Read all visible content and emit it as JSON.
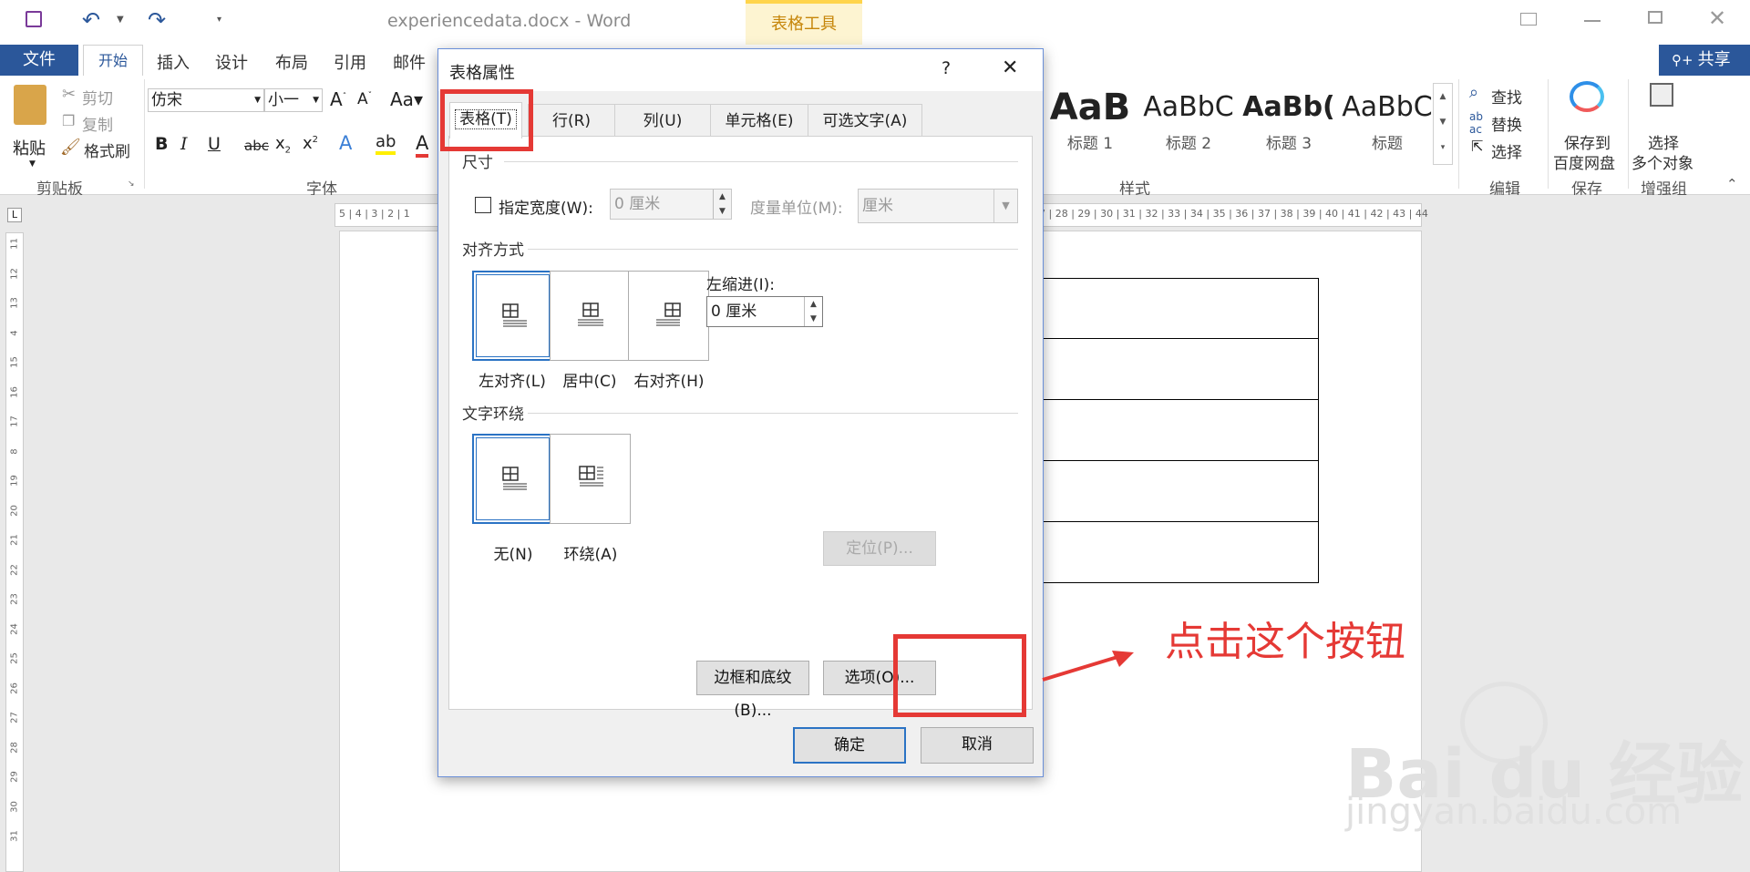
{
  "titlebar": {
    "doc_title": "experiencedata.docx - Word",
    "context_tab": "表格工具"
  },
  "tabs": {
    "file": "文件",
    "home": "开始",
    "insert": "插入",
    "design": "设计",
    "layout": "布局",
    "references": "引用",
    "mailings": "邮件",
    "share": "共享"
  },
  "ribbon": {
    "clipboard": {
      "paste": "粘贴",
      "cut": "剪切",
      "copy": "复制",
      "format_painter": "格式刷",
      "label": "剪贴板"
    },
    "font": {
      "name": "仿宋",
      "size": "小一",
      "label": "字体"
    },
    "styles": {
      "items": [
        {
          "preview": "AaB",
          "name": "标题 1"
        },
        {
          "preview": "AaBbC",
          "name": "标题 2"
        },
        {
          "preview": "AaBb(",
          "name": "标题 3"
        },
        {
          "preview": "AaBbC",
          "name": "标题"
        }
      ],
      "label": "样式"
    },
    "editing": {
      "find": "查找",
      "replace": "替换",
      "select": "选择",
      "label": "编辑"
    },
    "save": {
      "line1": "保存到",
      "line2": "百度网盘",
      "label": "保存"
    },
    "enhance": {
      "line1": "选择",
      "line2": "多个对象",
      "label": "增强组"
    }
  },
  "ruler": {
    "left_ticks": "5 | 4 | 3 | 2 | 1",
    "right_ticks": "7 | 28 | 29 | 30 | 31 | 32 | 33 | 34 | 35 | 36 | 37 | 38 | 39 | 40 | 41 | 42 | 43 | 44",
    "vertical_ticks": [
      "11",
      "12",
      "13",
      "4",
      "15",
      "16",
      "17",
      "8",
      "19",
      "20",
      "21",
      "22",
      "23",
      "24",
      "25",
      "26",
      "27",
      "28",
      "29",
      "30",
      "31"
    ]
  },
  "dialog": {
    "title": "表格属性",
    "help": "?",
    "close": "✕",
    "tabs": [
      "表格(T)",
      "行(R)",
      "列(U)",
      "单元格(E)",
      "可选文字(A)"
    ],
    "size": {
      "section": "尺寸",
      "preferred_width_label": "指定宽度(W):",
      "width_value": "0 厘米",
      "unit_label": "度量单位(M):",
      "unit_value": "厘米"
    },
    "alignment": {
      "section": "对齐方式",
      "options": [
        "左对齐(L)",
        "居中(C)",
        "右对齐(H)"
      ],
      "indent_label": "左缩进(I):",
      "indent_value": "0 厘米"
    },
    "wrapping": {
      "section": "文字环绕",
      "options": [
        "无(N)",
        "环绕(A)"
      ],
      "positioning": "定位(P)..."
    },
    "borders_button": "边框和底纹(B)...",
    "options_button": "选项(O)...",
    "ok": "确定",
    "cancel": "取消"
  },
  "annotation": {
    "text": "点击这个按钮",
    "color": "#e53935"
  },
  "watermark": {
    "brand": "Bai du 经验",
    "url": "jingyan.baidu.com"
  }
}
